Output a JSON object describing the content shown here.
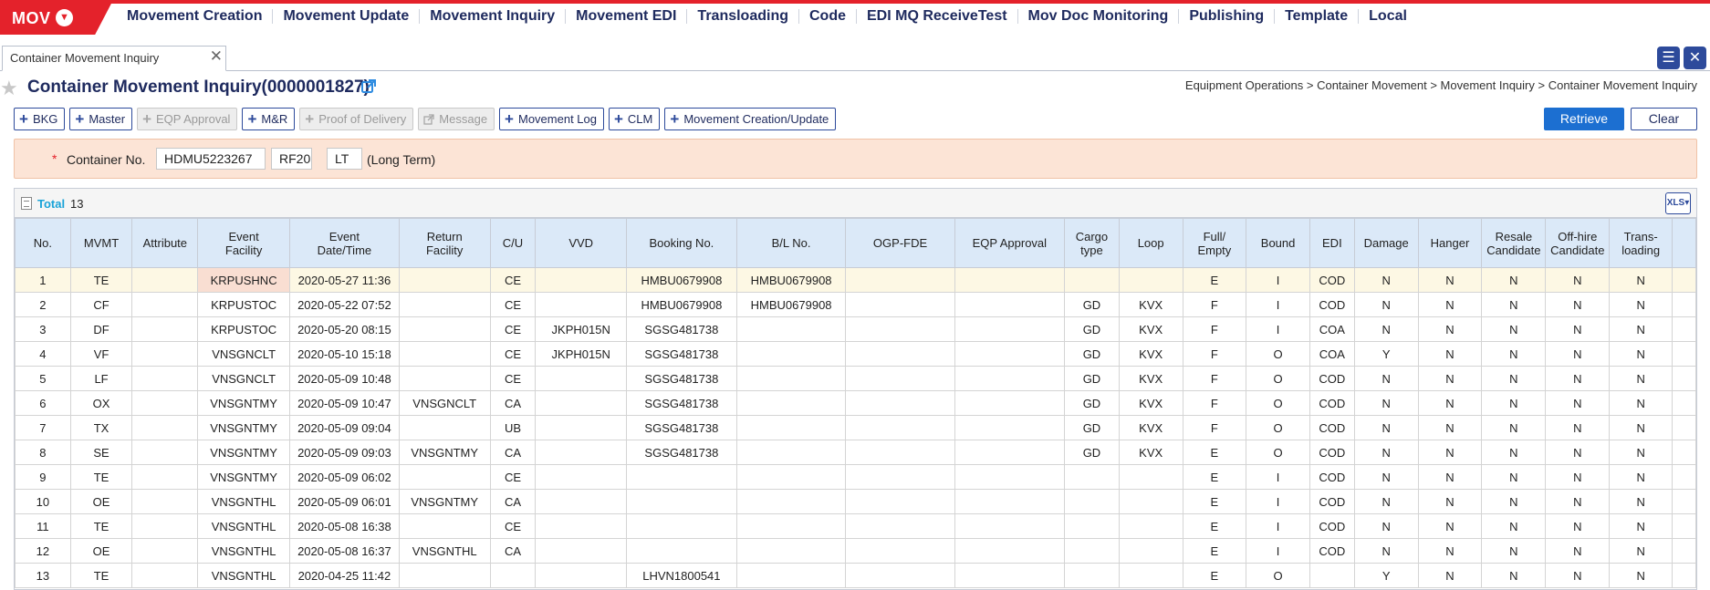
{
  "app": {
    "brand": "MOV"
  },
  "menu": [
    "Movement Creation",
    "Movement Update",
    "Movement Inquiry",
    "Movement EDI",
    "Transloading",
    "Code",
    "EDI MQ ReceiveTest",
    "Mov Doc Monitoring",
    "Publishing",
    "Template",
    "Local"
  ],
  "tab": {
    "label": "Container Movement Inquiry"
  },
  "page": {
    "title": "Container Movement Inquiry(0000001827)",
    "breadcrumb": "Equipment Operations > Container Movement > Movement Inquiry > Container Movement Inquiry"
  },
  "toolbar": {
    "buttons": [
      "BKG",
      "Master",
      "EQP Approval",
      "M&R",
      "Proof of Delivery",
      "Message",
      "Movement Log",
      "CLM",
      "Movement Creation/Update"
    ],
    "retrieve": "Retrieve",
    "clear": "Clear"
  },
  "search": {
    "required_mark": "*",
    "label": "Container No.",
    "container_no": "HDMU5223267",
    "type": "RF20",
    "term": "LT",
    "term_desc": "(Long Term)"
  },
  "grid": {
    "total_label": "Total",
    "total": "13",
    "columns": [
      "No.",
      "MVMT",
      "Attribute",
      "Event\nFacility",
      "Event\nDate/Time",
      "Return\nFacility",
      "C/U",
      "VVD",
      "Booking No.",
      "B/L No.",
      "OGP-FDE",
      "EQP Approval",
      "Cargo\ntype",
      "Loop",
      "Full/\nEmpty",
      "Bound",
      "EDI",
      "Damage",
      "Hanger",
      "Resale\nCandidate",
      "Off-hire\nCandidate",
      "Trans-\nloading"
    ],
    "rows": [
      [
        "1",
        "TE",
        "",
        "KRPUSHNC",
        "2020-05-27 11:36",
        "",
        "CE",
        "",
        "HMBU0679908",
        "HMBU0679908",
        "",
        "",
        "",
        "",
        "E",
        "I",
        "COD",
        "N",
        "N",
        "N",
        "N",
        "N"
      ],
      [
        "2",
        "CF",
        "",
        "KRPUSTOC",
        "2020-05-22 07:52",
        "",
        "CE",
        "",
        "HMBU0679908",
        "HMBU0679908",
        "",
        "",
        "GD",
        "KVX",
        "F",
        "I",
        "COD",
        "N",
        "N",
        "N",
        "N",
        "N"
      ],
      [
        "3",
        "DF",
        "",
        "KRPUSTOC",
        "2020-05-20 08:15",
        "",
        "CE",
        "JKPH015N",
        "SGSG481738",
        "",
        "",
        "",
        "GD",
        "KVX",
        "F",
        "I",
        "COA",
        "N",
        "N",
        "N",
        "N",
        "N"
      ],
      [
        "4",
        "VF",
        "",
        "VNSGNCLT",
        "2020-05-10 15:18",
        "",
        "CE",
        "JKPH015N",
        "SGSG481738",
        "",
        "",
        "",
        "GD",
        "KVX",
        "F",
        "O",
        "COA",
        "Y",
        "N",
        "N",
        "N",
        "N"
      ],
      [
        "5",
        "LF",
        "",
        "VNSGNCLT",
        "2020-05-09 10:48",
        "",
        "CE",
        "",
        "SGSG481738",
        "",
        "",
        "",
        "GD",
        "KVX",
        "F",
        "O",
        "COD",
        "N",
        "N",
        "N",
        "N",
        "N"
      ],
      [
        "6",
        "OX",
        "",
        "VNSGNTMY",
        "2020-05-09 10:47",
        "VNSGNCLT",
        "CA",
        "",
        "SGSG481738",
        "",
        "",
        "",
        "GD",
        "KVX",
        "F",
        "O",
        "COD",
        "N",
        "N",
        "N",
        "N",
        "N"
      ],
      [
        "7",
        "TX",
        "",
        "VNSGNTMY",
        "2020-05-09 09:04",
        "",
        "UB",
        "",
        "SGSG481738",
        "",
        "",
        "",
        "GD",
        "KVX",
        "F",
        "O",
        "COD",
        "N",
        "N",
        "N",
        "N",
        "N"
      ],
      [
        "8",
        "SE",
        "",
        "VNSGNTMY",
        "2020-05-09 09:03",
        "VNSGNTMY",
        "CA",
        "",
        "SGSG481738",
        "",
        "",
        "",
        "GD",
        "KVX",
        "E",
        "O",
        "COD",
        "N",
        "N",
        "N",
        "N",
        "N"
      ],
      [
        "9",
        "TE",
        "",
        "VNSGNTMY",
        "2020-05-09 06:02",
        "",
        "CE",
        "",
        "",
        "",
        "",
        "",
        "",
        "",
        "E",
        "I",
        "COD",
        "N",
        "N",
        "N",
        "N",
        "N"
      ],
      [
        "10",
        "OE",
        "",
        "VNSGNTHL",
        "2020-05-09 06:01",
        "VNSGNTMY",
        "CA",
        "",
        "",
        "",
        "",
        "",
        "",
        "",
        "E",
        "I",
        "COD",
        "N",
        "N",
        "N",
        "N",
        "N"
      ],
      [
        "11",
        "TE",
        "",
        "VNSGNTHL",
        "2020-05-08 16:38",
        "",
        "CE",
        "",
        "",
        "",
        "",
        "",
        "",
        "",
        "E",
        "I",
        "COD",
        "N",
        "N",
        "N",
        "N",
        "N"
      ],
      [
        "12",
        "OE",
        "",
        "VNSGNTHL",
        "2020-05-08 16:37",
        "VNSGNTHL",
        "CA",
        "",
        "",
        "",
        "",
        "",
        "",
        "",
        "E",
        "I",
        "COD",
        "N",
        "N",
        "N",
        "N",
        "N"
      ],
      [
        "13",
        "TE",
        "",
        "VNSGNTHL",
        "2020-04-25 11:42",
        "",
        "",
        "",
        "LHVN1800541",
        "",
        "",
        "",
        "",
        "",
        "E",
        "O",
        "",
        "Y",
        "N",
        "N",
        "N",
        "N"
      ]
    ]
  },
  "colors": {
    "brand_red": "#e4222b",
    "navy": "#1e2a5e",
    "primary_blue": "#1c6fd1",
    "search_bg": "#fce4d6",
    "header_bg": "#dbe9f8",
    "selected_row": "#fdf8e4"
  },
  "icons": [
    "chevron-down-icon",
    "close-icon",
    "menu-icon",
    "star-icon",
    "external-link-icon",
    "plus-icon",
    "list-icon",
    "excel-export-icon"
  ]
}
